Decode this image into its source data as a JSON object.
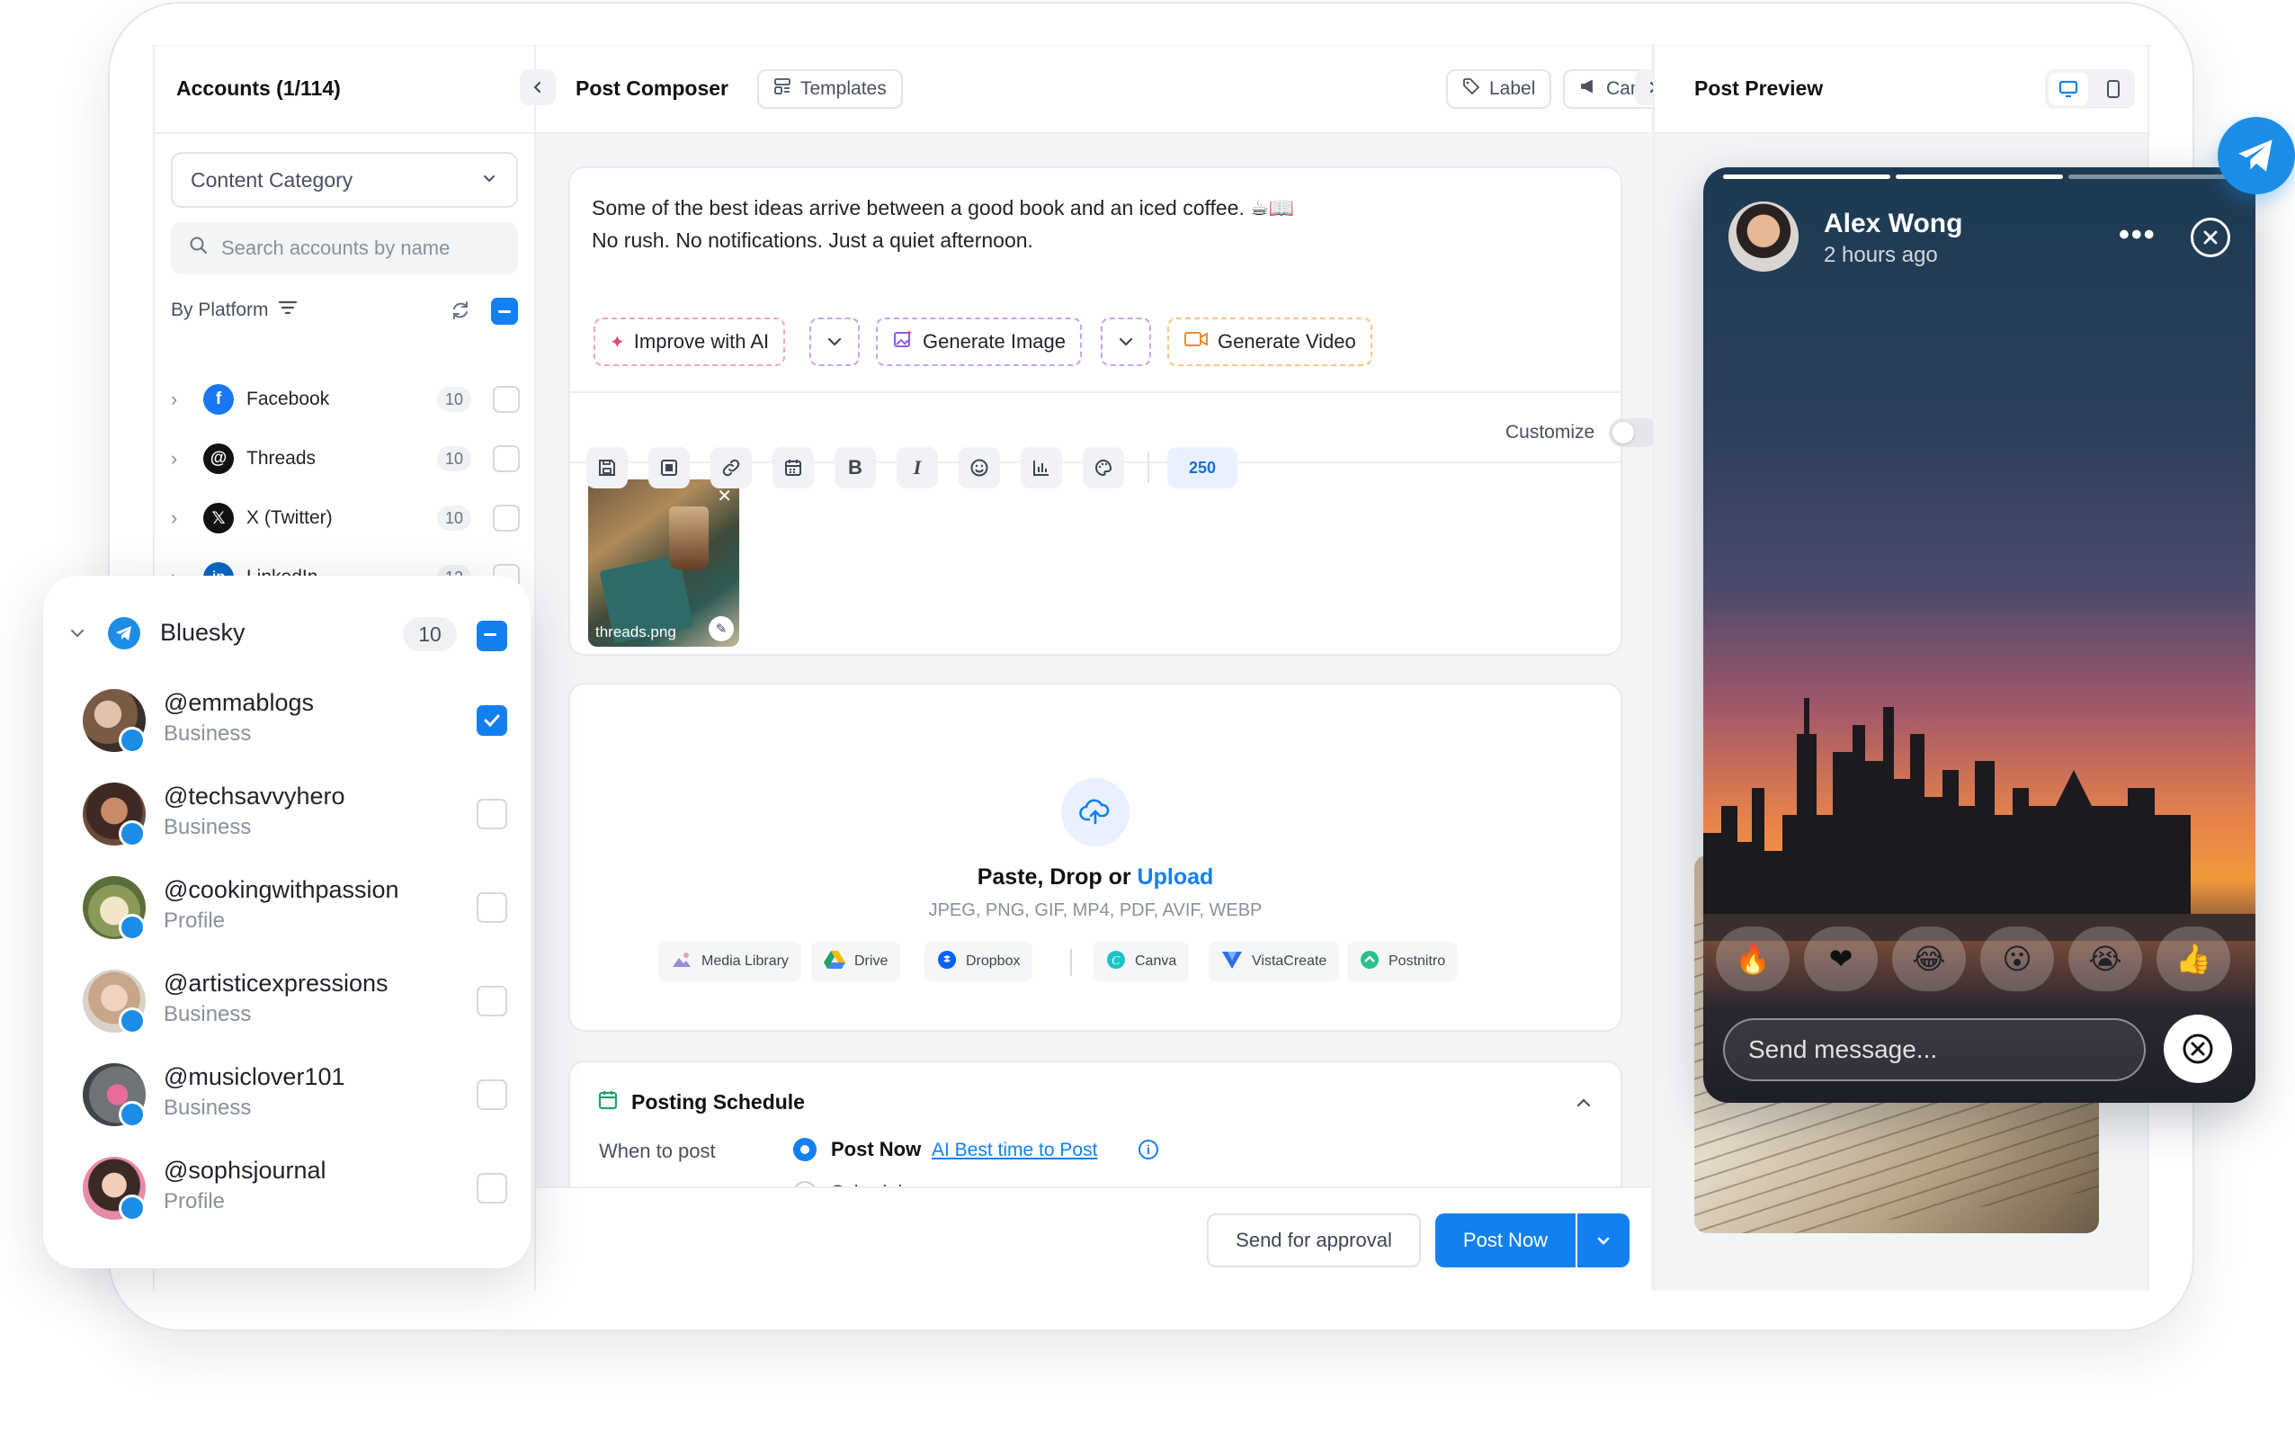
{
  "left_panel": {
    "title": "Accounts (1/114)",
    "category_select": "Content Category",
    "search_placeholder": "Search accounts by name",
    "by_platform": "By Platform",
    "platforms": [
      {
        "name": "Facebook",
        "count": "10",
        "color": "#1877f2"
      },
      {
        "name": "Threads",
        "count": "10",
        "color": "#111111"
      },
      {
        "name": "X (Twitter)",
        "count": "10",
        "color": "#111111"
      },
      {
        "name": "LinkedIn",
        "count": "12",
        "color": "#0a66c2"
      }
    ]
  },
  "bluesky_panel": {
    "platform": "Bluesky",
    "count": "10",
    "accounts": [
      {
        "handle": "@emmablogs",
        "type": "Business",
        "checked": true
      },
      {
        "handle": "@techsavvyhero",
        "type": "Business",
        "checked": false
      },
      {
        "handle": "@cookingwithpassion",
        "type": "Profile",
        "checked": false
      },
      {
        "handle": "@artisticexpressions",
        "type": "Business",
        "checked": false
      },
      {
        "handle": "@musiclover101",
        "type": "Business",
        "checked": false
      },
      {
        "handle": "@sophsjournal",
        "type": "Profile",
        "checked": false
      }
    ]
  },
  "composer": {
    "title": "Post Composer",
    "templates": "Templates",
    "label": "Label",
    "campaign": "Campaign",
    "text_line1": "Some of the best ideas arrive between a good book and an iced coffee. ☕📖",
    "text_line2": "No rush. No notifications. Just a quiet afternoon.",
    "improve_ai": "Improve with AI",
    "generate_image": "Generate Image",
    "generate_video": "Generate Video",
    "char_count": "250",
    "customize": "Customize",
    "attachment_name": "threads.png"
  },
  "upload": {
    "title_prefix": "Paste, Drop or ",
    "title_link": "Upload",
    "formats": "JPEG, PNG, GIF, MP4, PDF, AVIF, WEBP",
    "sources": [
      "Media Library",
      "Drive",
      "Dropbox",
      "Canva",
      "VistaCreate",
      "Postnitro"
    ]
  },
  "schedule": {
    "title": "Posting Schedule",
    "when_label": "When to post",
    "post_now": "Post Now",
    "ai_best": "AI Best time to Post",
    "schedule": "Schedule"
  },
  "footer": {
    "send_approval": "Send for approval",
    "post_now": "Post Now"
  },
  "preview": {
    "title": "Post Preview",
    "story_user": "Alex Wong",
    "story_time": "2 hours ago",
    "send_placeholder": "Send message...",
    "reactions": [
      "🔥",
      "❤",
      "😂",
      "😮",
      "😭",
      "👍"
    ]
  },
  "colors": {
    "accent": "#1280f0",
    "telegram": "#1c8de6"
  }
}
